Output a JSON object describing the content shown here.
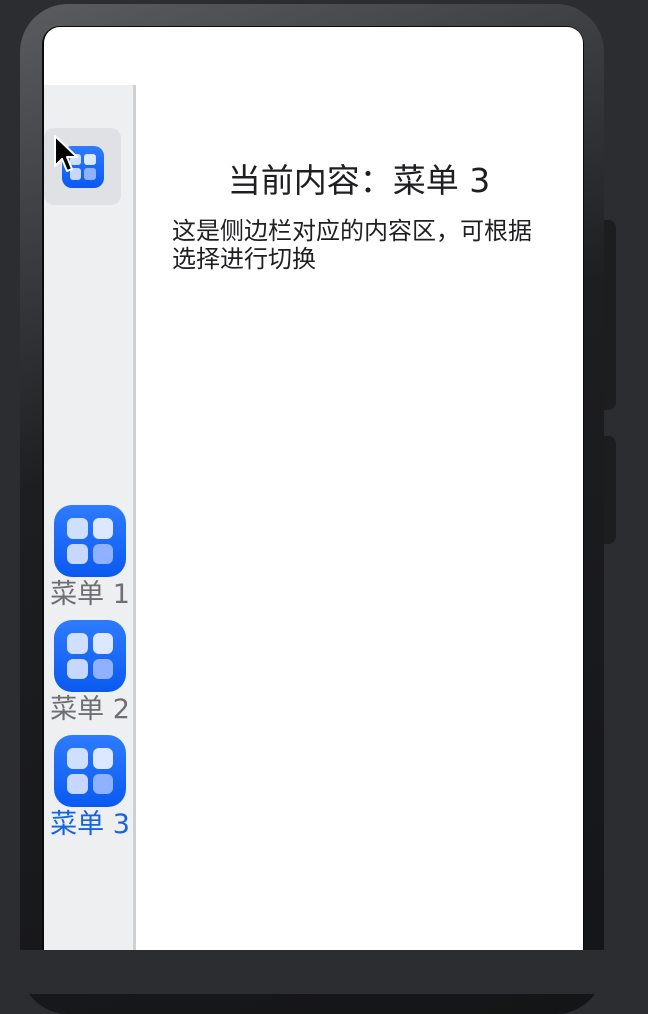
{
  "sidebar": {
    "toggle": {
      "icon": "app-grid-icon"
    },
    "items": [
      {
        "label": "菜单 1",
        "icon": "app-grid-icon",
        "active": false
      },
      {
        "label": "菜单 2",
        "icon": "app-grid-icon",
        "active": false
      },
      {
        "label": "菜单 3",
        "icon": "app-grid-icon",
        "active": true
      }
    ]
  },
  "content": {
    "title": "当前内容：菜单 3",
    "body": "这是侧边栏对应的内容区，可根据选择进行切换"
  },
  "colors": {
    "accent": "#1662e6",
    "inactive_label": "#6f6f73",
    "sidebar_bg": "#eeeff1",
    "icon_blue": "#0a5af0"
  }
}
